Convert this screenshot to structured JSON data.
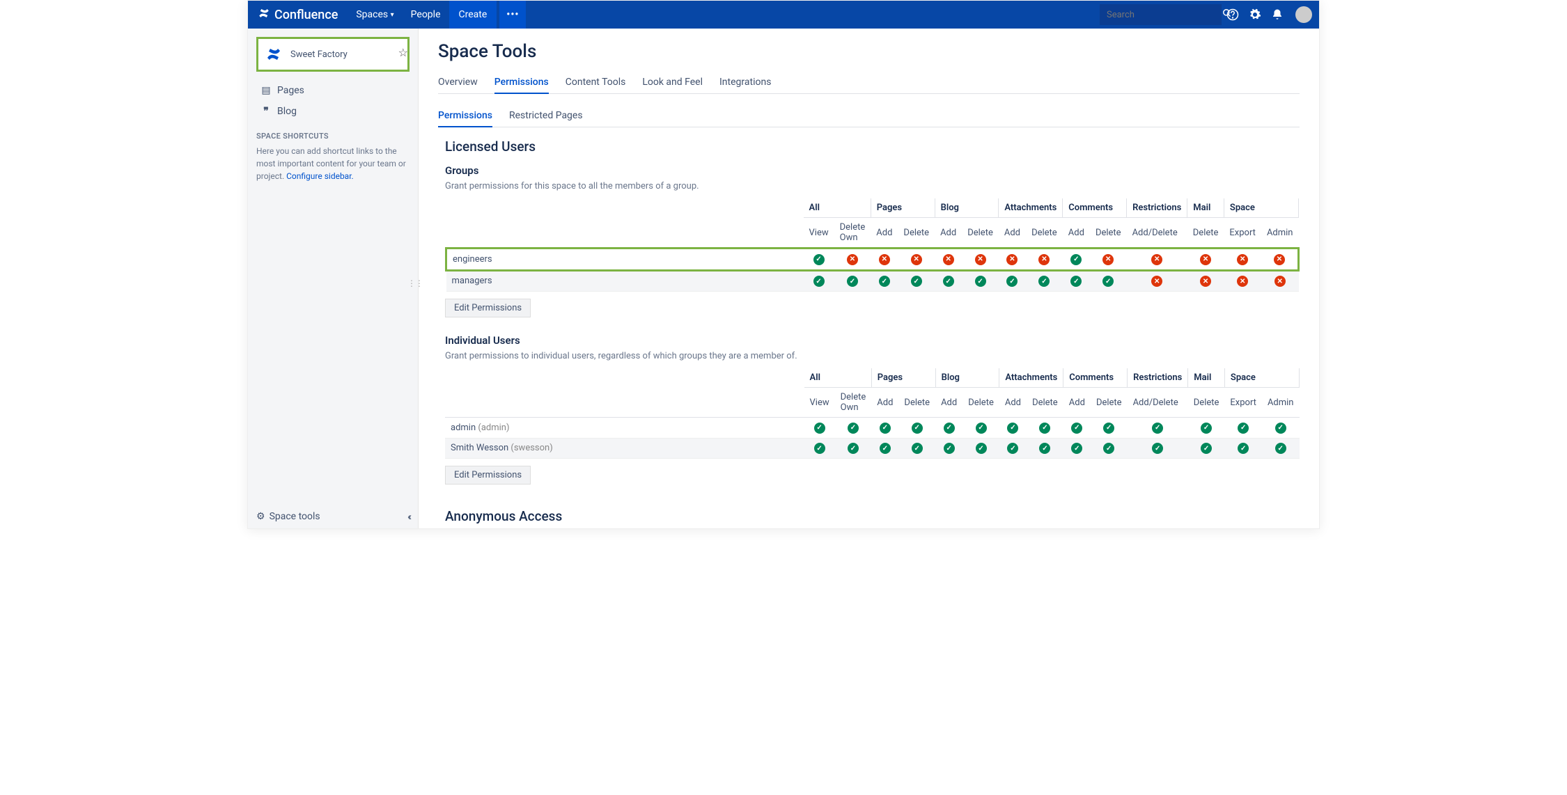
{
  "top": {
    "brand": "Confluence",
    "spaces": "Spaces",
    "people": "People",
    "create": "Create",
    "more": "•••",
    "search_ph": "Search"
  },
  "space": {
    "name": "Sweet Factory"
  },
  "sidebar": {
    "pages": "Pages",
    "blog": "Blog",
    "shortcuts_hdr": "SPACE SHORTCUTS",
    "shortcuts_help": "Here you can add shortcut links to the most important content for your team or project.",
    "configure": "Configure sidebar.",
    "space_tools": "Space tools"
  },
  "page": {
    "title": "Space Tools",
    "tabs": [
      "Overview",
      "Permissions",
      "Content Tools",
      "Look and Feel",
      "Integrations"
    ],
    "active_tab": 1,
    "subtabs": [
      "Permissions",
      "Restricted Pages"
    ],
    "active_sub": 0,
    "licensed": "Licensed Users",
    "anonymous": "Anonymous Access",
    "groups_hdr": "Groups",
    "groups_desc": "Grant permissions for this space to all the members of a group.",
    "users_hdr": "Individual Users",
    "users_desc": "Grant permissions to individual users, regardless of which groups they are a member of.",
    "edit_btn": "Edit Permissions"
  },
  "cols": {
    "groups": [
      "All",
      "Pages",
      "Blog",
      "Attachments",
      "Comments",
      "Restrictions",
      "Mail",
      "Space"
    ],
    "sub": [
      "View",
      "Delete Own",
      "Add",
      "Delete",
      "Add",
      "Delete",
      "Add",
      "Delete",
      "Add",
      "Delete",
      "Add/Delete",
      "Delete",
      "Export",
      "Admin"
    ]
  },
  "group_rows": [
    {
      "name": "engineers",
      "hl": true,
      "p": [
        1,
        0,
        0,
        0,
        0,
        0,
        0,
        0,
        1,
        0,
        0,
        0,
        0,
        0
      ]
    },
    {
      "name": "managers",
      "p": [
        1,
        1,
        1,
        1,
        1,
        1,
        1,
        1,
        1,
        1,
        0,
        0,
        0,
        0
      ]
    }
  ],
  "user_rows": [
    {
      "name": "admin",
      "uname": "(admin)",
      "p": [
        1,
        1,
        1,
        1,
        1,
        1,
        1,
        1,
        1,
        1,
        1,
        1,
        1,
        1
      ]
    },
    {
      "name": "Smith Wesson",
      "uname": "(swesson)",
      "p": [
        1,
        1,
        1,
        1,
        1,
        1,
        1,
        1,
        1,
        1,
        1,
        1,
        1,
        1
      ]
    }
  ]
}
